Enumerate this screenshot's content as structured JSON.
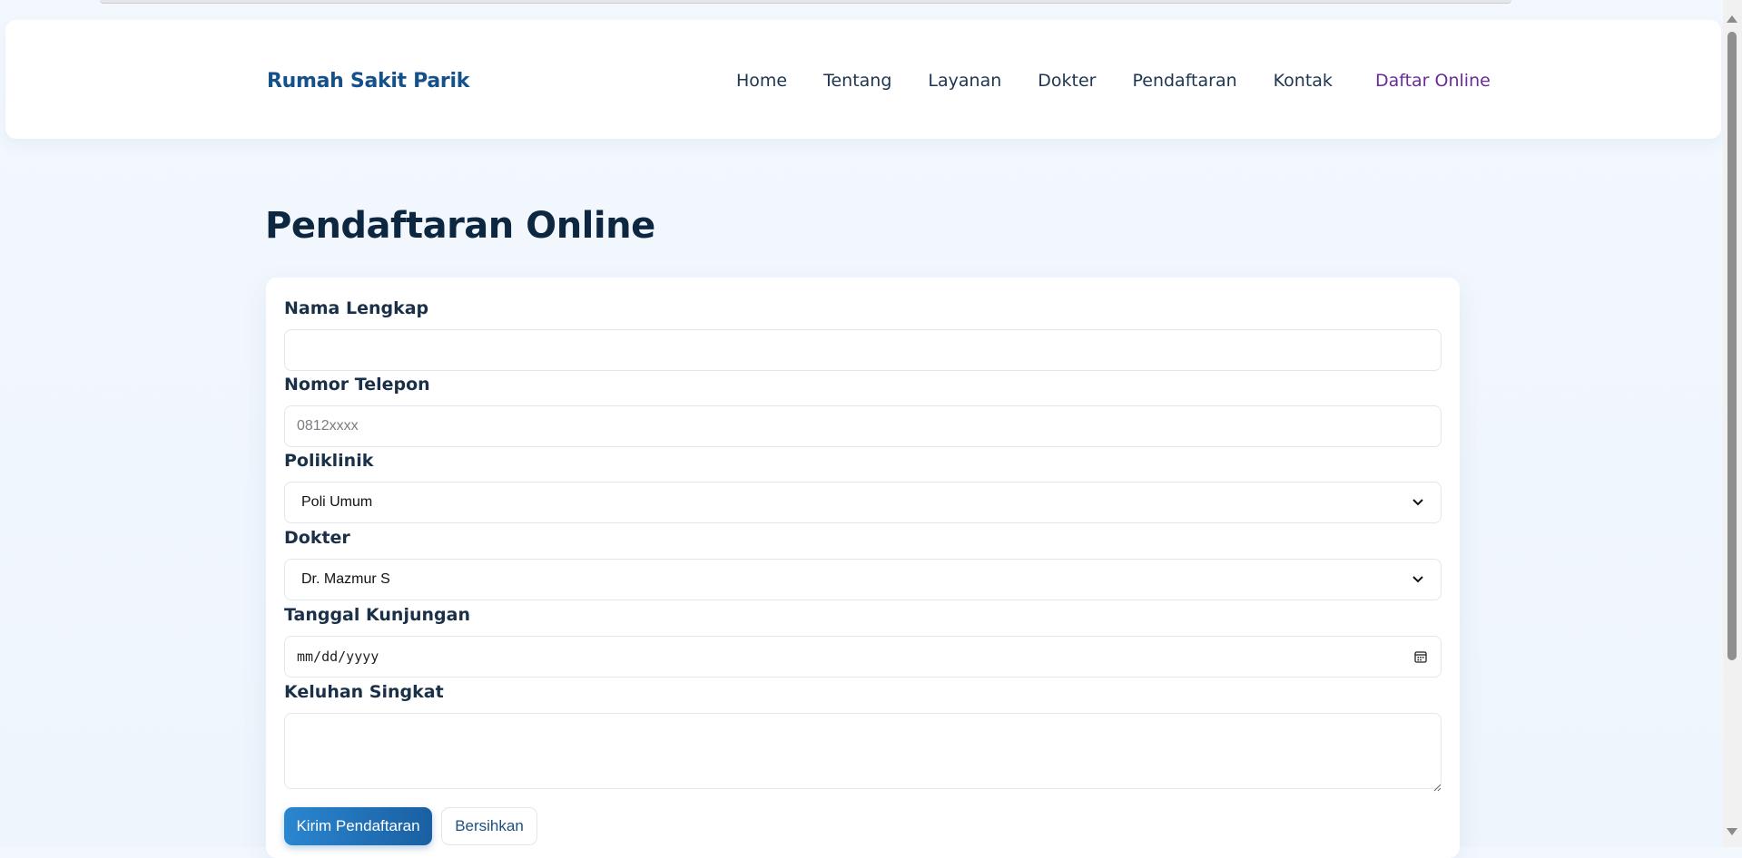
{
  "header": {
    "brand": "Rumah Sakit Parik",
    "nav": [
      "Home",
      "Tentang",
      "Layanan",
      "Dokter",
      "Pendaftaran",
      "Kontak"
    ],
    "cta": "Daftar Online",
    "cta_color": "#6a2c9a",
    "brand_color": "#14508a"
  },
  "page": {
    "title": "Pendaftaran Online"
  },
  "form": {
    "name_label": "Nama Lengkap",
    "name_value": "",
    "phone_label": "Nomor Telepon",
    "phone_placeholder": "0812xxxx",
    "clinic_label": "Poliklinik",
    "clinic_selected": "Poli Umum",
    "doctor_label": "Dokter",
    "doctor_selected": "Dr. Mazmur S",
    "date_label": "Tanggal Kunjungan",
    "date_placeholder": "mm/dd/yyyy",
    "complaint_label": "Keluhan Singkat",
    "complaint_value": "",
    "submit_label": "Kirim Pendaftaran",
    "reset_label": "Bersihkan"
  },
  "icons": {
    "select_arrow": "chevron-down-icon",
    "date_picker": "calendar-icon",
    "resize": "resize-grip-icon"
  }
}
